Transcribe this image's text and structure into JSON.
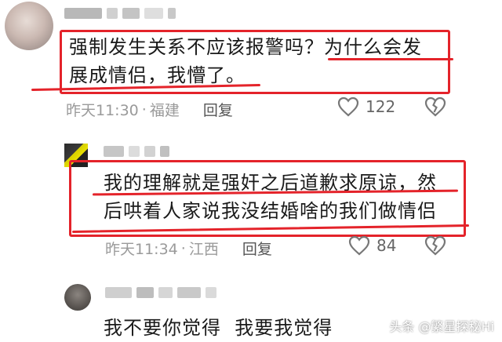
{
  "comments": [
    {
      "line1": "强制发生关系不应该报警吗？为什么会发",
      "line2": "展成情侣，我懵了。",
      "time": "昨天11:30",
      "dot": "·",
      "location": "福建",
      "reply": "回复",
      "likes": "122"
    },
    {
      "line1": "我的理解就是强奸之后道歉求原谅，然",
      "line2": "后哄着人家说我没结婚啥的我们做情侣",
      "time": "昨天11:34",
      "dot": "·",
      "location": "江西",
      "reply": "回复",
      "likes": "84"
    },
    {
      "line1": "我不要你觉得  我要我觉得"
    }
  ],
  "watermark": "头条 @繁星探秘Hi",
  "colors": {
    "highlight": "#e4232a",
    "meta": "#9a9a9a"
  }
}
